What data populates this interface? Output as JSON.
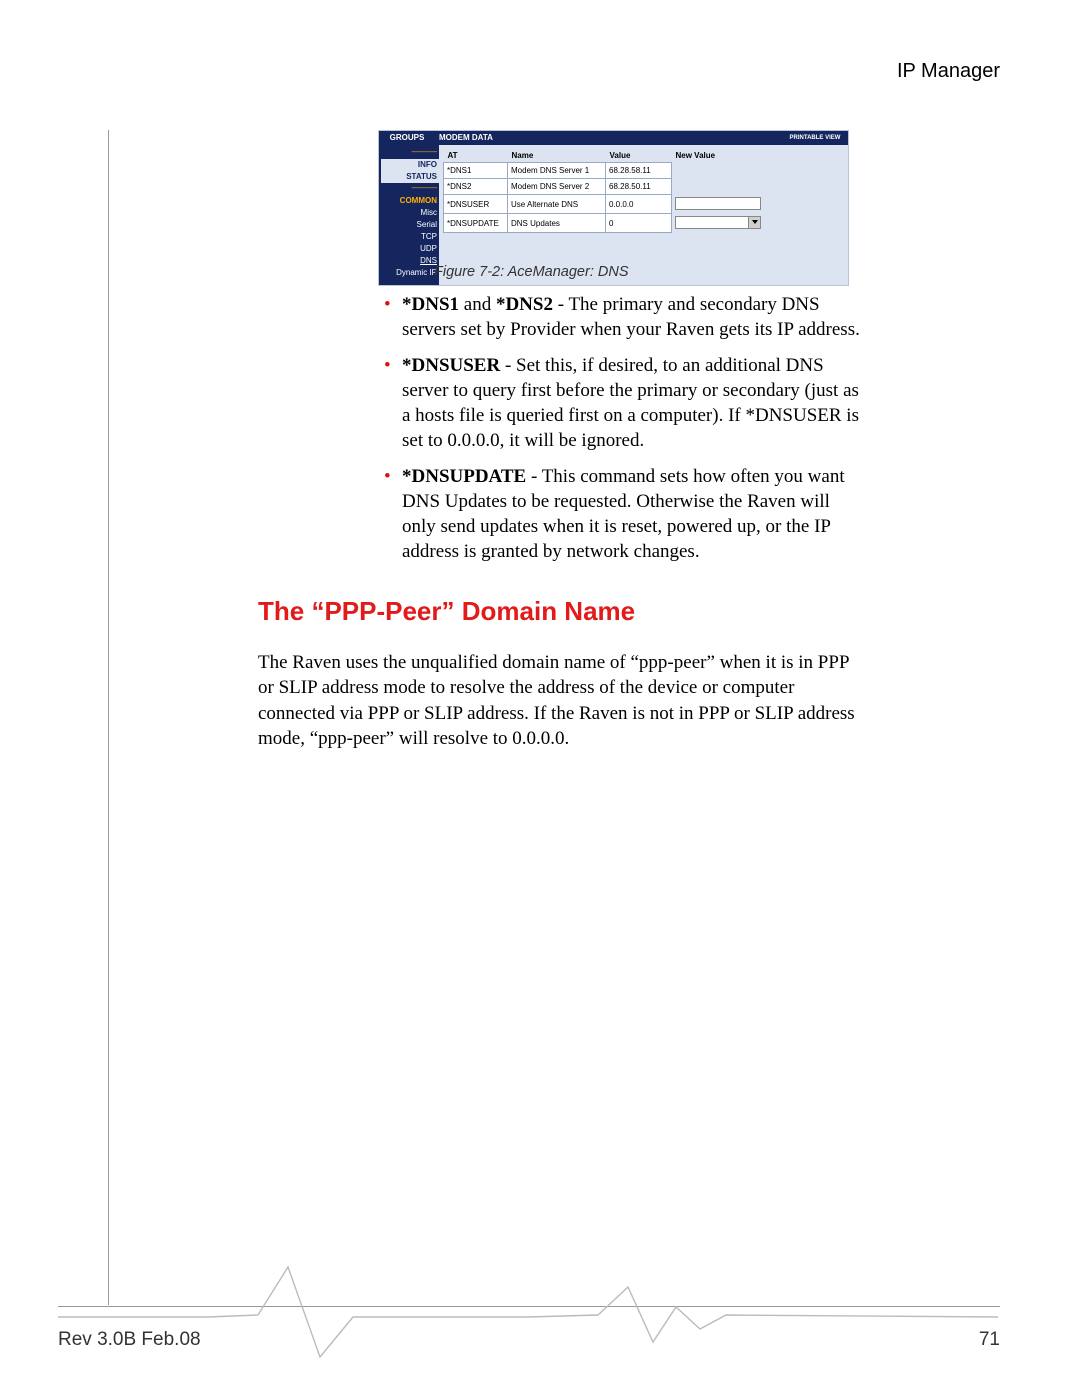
{
  "header": {
    "title": "IP Manager"
  },
  "screenshot": {
    "tabs": {
      "groups": "GROUPS",
      "modem_data": "MODEM DATA",
      "printable": "PRINTABLE VIEW"
    },
    "sidebar": {
      "sep": "--------------",
      "items": [
        "INFO",
        "STATUS",
        "COMMON",
        "Misc",
        "Serial",
        "TCP",
        "UDP",
        "DNS",
        "Dynamic IP"
      ]
    },
    "table": {
      "headers": [
        "AT",
        "Name",
        "Value",
        "New Value"
      ],
      "rows": [
        {
          "at": "*DNS1",
          "name": "Modem DNS Server 1",
          "value": "68.28.58.11",
          "input": "none"
        },
        {
          "at": "*DNS2",
          "name": "Modem DNS Server 2",
          "value": "68.28.50.11",
          "input": "none"
        },
        {
          "at": "*DNSUSER",
          "name": "Use Alternate DNS",
          "value": "0.0.0.0",
          "input": "text"
        },
        {
          "at": "*DNSUPDATE",
          "name": "DNS Updates",
          "value": "0",
          "input": "select"
        }
      ]
    }
  },
  "caption": "Figure 7-2: AceManager: DNS",
  "bullets": [
    {
      "b": "*DNS1",
      "mid": " and ",
      "b2": "*DNS2",
      "rest": " - The primary and secondary DNS servers set by Provider when your Raven gets its IP address."
    },
    {
      "b": "*DNSUSER",
      "rest": " - Set this, if desired, to an additional DNS server to query first before the primary or secondary (just as a hosts file is queried first on a computer). If *DNSUSER is set to 0.0.0.0, it will be ignored."
    },
    {
      "b": "*DNSUPDATE",
      "rest": " - This command sets how often you want DNS Updates to be requested. Otherwise the Raven will only send updates when it is reset, powered up, or the IP address is granted by network changes."
    }
  ],
  "heading": "The “PPP-Peer” Domain Name",
  "ppp_body": "The Raven uses the unqualified domain name of “ppp-peer” when it is in PPP or SLIP address mode to resolve the address of the device or computer connected via PPP or SLIP address. If the Raven is not in PPP or SLIP address mode, “ppp-peer” will resolve to 0.0.0.0.",
  "footer": {
    "rev": "Rev 3.0B  Feb.08",
    "page": "71"
  }
}
